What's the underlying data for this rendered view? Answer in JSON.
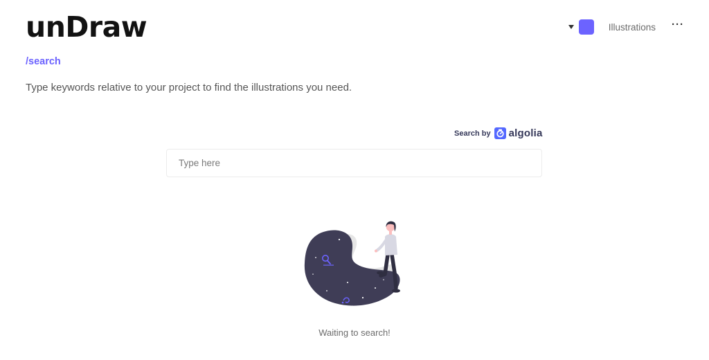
{
  "brand": {
    "name": "unDraw"
  },
  "header": {
    "nav_illustrations": "Illustrations",
    "more_label": "···",
    "accent_color": "#6c63ff"
  },
  "page": {
    "route": "/search",
    "description": "Type keywords relative to your project to find the illustrations you need."
  },
  "search": {
    "powered_by": "Search by",
    "provider": "algolia",
    "placeholder": "Type here",
    "value": ""
  },
  "empty_state": {
    "message": "Waiting to search!"
  },
  "colors": {
    "accent": "#6c63ff",
    "dark": "#3f3d56",
    "algolia": "#5468ff"
  }
}
